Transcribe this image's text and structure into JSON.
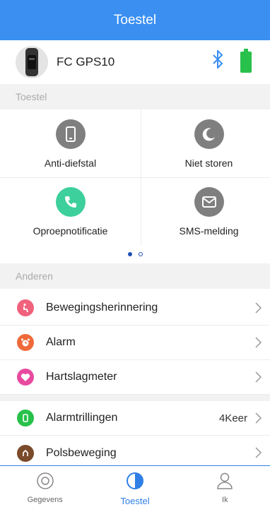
{
  "header": {
    "title": "Toestel"
  },
  "device": {
    "name": "FC GPS10"
  },
  "sections": {
    "device_label": "Toestel",
    "others_label": "Anderen"
  },
  "grid": {
    "tiles": [
      {
        "label": "Anti-diefstal",
        "icon": "phone-device-icon",
        "color": "#7f7f7f"
      },
      {
        "label": "Niet storen",
        "icon": "moon-icon",
        "color": "#7f7f7f"
      },
      {
        "label": "Oproepnotificatie",
        "icon": "phone-call-icon",
        "color": "#3dcf9c"
      },
      {
        "label": "SMS-melding",
        "icon": "envelope-icon",
        "color": "#7f7f7f"
      }
    ]
  },
  "pager": {
    "pages": 2,
    "current": 1
  },
  "list": [
    {
      "label": "Bewegingsherinnering",
      "value": "",
      "icon": "sitting-person-icon",
      "color": "#f0617c"
    },
    {
      "label": "Alarm",
      "value": "",
      "icon": "alarm-clock-icon",
      "color": "#ef6a3a"
    },
    {
      "label": "Hartslagmeter",
      "value": "",
      "icon": "heart-icon",
      "color": "#e84aa0"
    },
    {
      "label": "Alarmtrillingen",
      "value": "4Keer",
      "icon": "vibration-icon",
      "color": "#27c14b"
    },
    {
      "label": "Polsbeweging",
      "value": "",
      "icon": "wrist-icon",
      "color": "#7a4a2a"
    }
  ],
  "tabs": [
    {
      "label": "Gegevens",
      "icon": "data-circle-icon",
      "active": false
    },
    {
      "label": "Toestel",
      "icon": "device-half-circle-icon",
      "active": true
    },
    {
      "label": "Ik",
      "icon": "person-icon",
      "active": false
    }
  ],
  "colors": {
    "accent": "#3a8ff1",
    "bluetooth": "#3a8ff1",
    "battery": "#27c14b"
  }
}
